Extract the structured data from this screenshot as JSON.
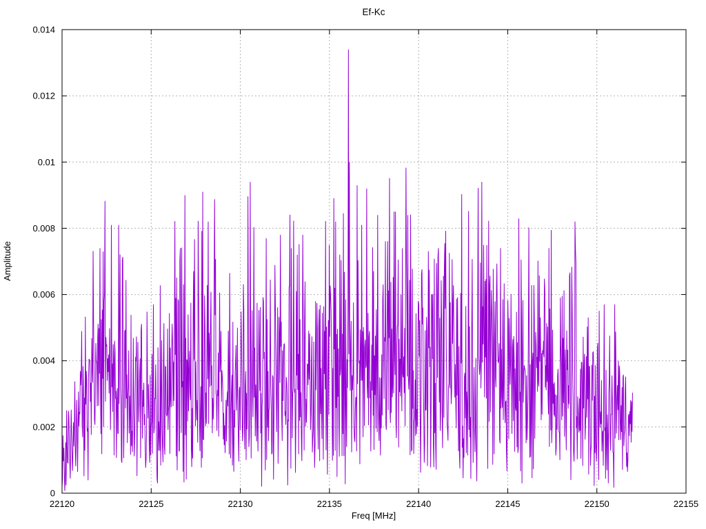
{
  "chart_data": {
    "type": "line",
    "title": "Ef-Kc",
    "xlabel": "Freq [MHz]",
    "ylabel": "Amplitude",
    "xlim": [
      22120,
      22155
    ],
    "ylim": [
      0,
      0.014
    ],
    "xtick_values": [
      22120,
      22125,
      22130,
      22135,
      22140,
      22145,
      22150,
      22155
    ],
    "xtick_labels": [
      "22120",
      "22125",
      "22130",
      "22135",
      "22140",
      "22145",
      "22150",
      "22155"
    ],
    "ytick_values": [
      0,
      0.002,
      0.004,
      0.006,
      0.008,
      0.01,
      0.012,
      0.014
    ],
    "ytick_labels": [
      "0",
      "0.002",
      "0.004",
      "0.006",
      "0.008",
      "0.01",
      "0.012",
      "0.014"
    ],
    "grid": true,
    "grid_style": "dotted",
    "legend": "none",
    "colors": {
      "line": "#9400d3",
      "grid": "#b0b0b0",
      "axis": "#000000",
      "background": "#ffffff"
    },
    "series": [
      {
        "name": "Ef-Kc",
        "description": "Dense noisy amplitude spectrum from 22120 to 22152 MHz; values read from plot",
        "x_start": 22120,
        "x_end": 22152,
        "n_points": 1250,
        "noise": {
          "distribution": "rayleigh",
          "sigma": 0.75,
          "seed": 20136,
          "r_min": 0.06,
          "r_max": 2.35
        },
        "envelope_mean_points": [
          [
            22120.0,
            0.001
          ],
          [
            22120.6,
            0.0015
          ],
          [
            22121.2,
            0.0028
          ],
          [
            22122.0,
            0.0035
          ],
          [
            22122.8,
            0.004
          ],
          [
            22123.6,
            0.0033
          ],
          [
            22124.6,
            0.003
          ],
          [
            22125.4,
            0.0029
          ],
          [
            22126.2,
            0.0034
          ],
          [
            22127.0,
            0.004
          ],
          [
            22128.0,
            0.004
          ],
          [
            22129.0,
            0.0036
          ],
          [
            22130.0,
            0.0036
          ],
          [
            22130.8,
            0.004
          ],
          [
            22131.6,
            0.0037
          ],
          [
            22132.4,
            0.0039
          ],
          [
            22133.2,
            0.004
          ],
          [
            22134.2,
            0.0036
          ],
          [
            22135.2,
            0.0041
          ],
          [
            22136.1,
            0.0047
          ],
          [
            22137.0,
            0.0043
          ],
          [
            22138.0,
            0.0041
          ],
          [
            22139.0,
            0.0043
          ],
          [
            22140.0,
            0.0039
          ],
          [
            22141.0,
            0.0041
          ],
          [
            22142.0,
            0.0038
          ],
          [
            22143.0,
            0.0039
          ],
          [
            22144.0,
            0.004
          ],
          [
            22145.0,
            0.0038
          ],
          [
            22146.0,
            0.0038
          ],
          [
            22147.0,
            0.0038
          ],
          [
            22148.0,
            0.0038
          ],
          [
            22149.0,
            0.0034
          ],
          [
            22149.8,
            0.0026
          ],
          [
            22150.6,
            0.0028
          ],
          [
            22151.4,
            0.0026
          ],
          [
            22152.0,
            0.0018
          ]
        ],
        "notable_peaks": [
          [
            22122.3,
            0.0073
          ],
          [
            22122.77,
            0.0081
          ],
          [
            22123.18,
            0.0081
          ],
          [
            22126.9,
            0.009
          ],
          [
            22127.9,
            0.0091
          ],
          [
            22128.2,
            0.0082
          ],
          [
            22130.55,
            0.0094
          ],
          [
            22131.45,
            0.0077
          ],
          [
            22132.25,
            0.0078
          ],
          [
            22133.2,
            0.0072
          ],
          [
            22133.5,
            0.0078
          ],
          [
            22135.0,
            0.0075
          ],
          [
            22135.35,
            0.0082
          ],
          [
            22136.07,
            0.0134
          ],
          [
            22136.12,
            0.01
          ],
          [
            22136.55,
            0.0093
          ],
          [
            22136.8,
            0.0081
          ],
          [
            22137.1,
            0.0092
          ],
          [
            22137.7,
            0.0084
          ],
          [
            22138.7,
            0.0085
          ],
          [
            22139.4,
            0.0084
          ],
          [
            22141.1,
            0.0074
          ],
          [
            22143.55,
            0.0094
          ],
          [
            22143.65,
            0.0075
          ],
          [
            22144.6,
            0.0074
          ],
          [
            22147.3,
            0.0074
          ],
          [
            22148.8,
            0.0074
          ],
          [
            22150.4,
            0.0057
          ],
          [
            22151.0,
            0.0057
          ]
        ],
        "notable_dips": [
          [
            22125.35,
            0.0003
          ],
          [
            22131.2,
            0.0002
          ],
          [
            22150.1,
            0.0004
          ]
        ],
        "max_point": {
          "x": 22136.07,
          "y": 0.0134
        }
      }
    ]
  }
}
